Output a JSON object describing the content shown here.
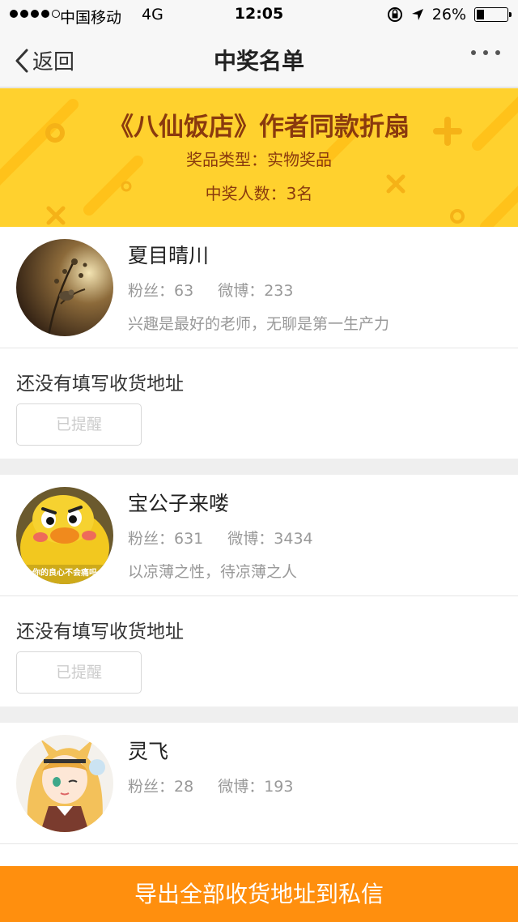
{
  "status_bar": {
    "carrier": "中国移动",
    "network": "4G",
    "time": "12:05",
    "battery_text": "26%",
    "battery_level": 0.26
  },
  "nav": {
    "back_label": "返回",
    "title": "中奖名单"
  },
  "banner": {
    "prize_name": "《八仙饭店》作者同款折扇",
    "prize_type": "奖品类型：实物奖品",
    "winner_count": "中奖人数：3名"
  },
  "winners": [
    {
      "name": "夏目晴川",
      "fans": "粉丝：63",
      "weibo": "微博：233",
      "bio": "兴趣是最好的老师，无聊是第一生产力",
      "address_status": "还没有填写收货地址",
      "remind_label": "已提醒"
    },
    {
      "name": "宝公子来喽",
      "fans": "粉丝：631",
      "weibo": "微博：3434",
      "bio": "以凉薄之性，待凉薄之人",
      "address_status": "还没有填写收货地址",
      "remind_label": "已提醒",
      "avatar_caption": "你的良心不会痛吗"
    },
    {
      "name": "灵飞",
      "fans": "粉丝：28",
      "weibo": "微博：193"
    }
  ],
  "footer": {
    "export_label": "导出全部收货地址到私信"
  },
  "colors": {
    "banner_bg": "#ffd12e",
    "banner_text": "#8a3a0e",
    "export_bg": "#ff8f0e"
  }
}
